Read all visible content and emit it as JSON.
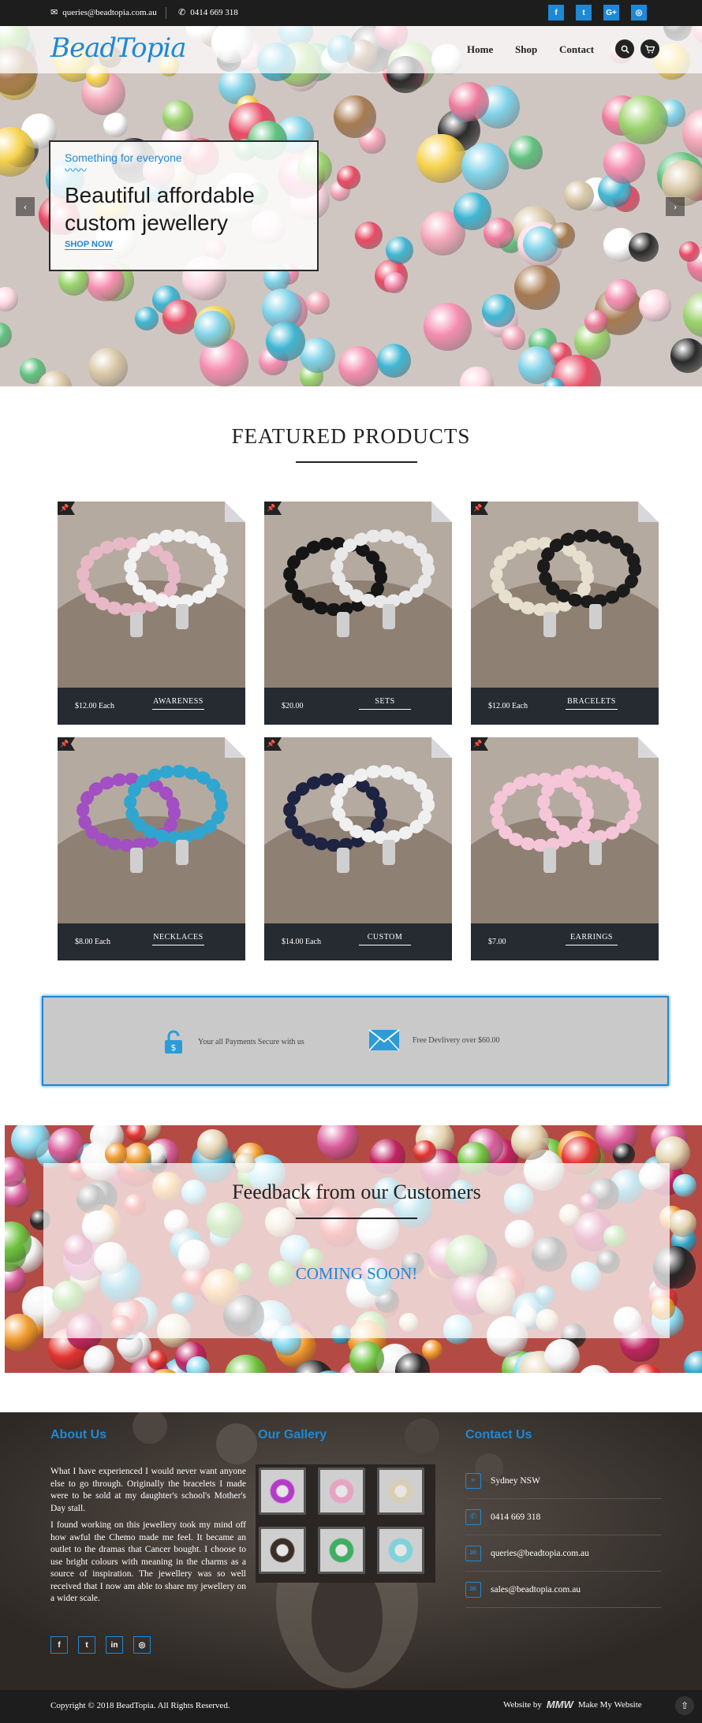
{
  "topbar": {
    "email": "queries@beadtopia.com.au",
    "phone": "0414 669 318",
    "social": [
      {
        "icon": "facebook-icon",
        "glyph": "f"
      },
      {
        "icon": "twitter-icon",
        "glyph": "t"
      },
      {
        "icon": "google-plus-icon",
        "glyph": "G+"
      },
      {
        "icon": "instagram-icon",
        "glyph": "◎"
      }
    ]
  },
  "nav": {
    "logo": "BeadTopia",
    "links": [
      "Home",
      "Shop",
      "Contact"
    ],
    "search_icon": "search-icon",
    "cart_icon": "cart-icon"
  },
  "hero": {
    "subtitle": "Something for everyone",
    "title_line1": "Beautiful affordable",
    "title_line2": "custom jewellery",
    "cta": "SHOP NOW"
  },
  "featured": {
    "title": "FEATURED PRODUCTS",
    "products": [
      {
        "price": "$12.00  Each",
        "category": "AWARENESS"
      },
      {
        "price": "$20.00",
        "category": "SETS"
      },
      {
        "price": "$12.00  Each",
        "category": "BRACELETS"
      },
      {
        "price": "$8.00  Each",
        "category": "NECKLACES"
      },
      {
        "price": "$14.00  Each",
        "category": "CUSTOM"
      },
      {
        "price": "$7.00",
        "category": "EARRINGS"
      }
    ]
  },
  "secure": {
    "payments": "Your all Payments Secure with us",
    "delivery": "Free Devlivery over $60.00"
  },
  "feedback": {
    "title": "Feedback from our Customers",
    "status": "COMING SOON!"
  },
  "footer": {
    "about_title": "About Us",
    "about_p1": "What I have experienced I would never want anyone else to go through. Originally the bracelets I made were to be sold at my daughter's school's Mother's Day stall.",
    "about_p2": "I found working on this jewellery took my mind off how awful the Chemo made me feel. It became an outlet to the dramas that Cancer bought. I choose to use bright colours with meaning in the charms as a source of inspiration. The jewellery was so well received that I now am able to share my jewellery on a wider scale.",
    "gallery_title": "Our Gallery",
    "contact_title": "Contact Us",
    "contact": [
      {
        "icon": "location-icon",
        "text": "Sydney NSW"
      },
      {
        "icon": "phone-icon",
        "text": "0414 669 318"
      },
      {
        "icon": "mail-icon",
        "text": "queries@beadtopia.com.au"
      },
      {
        "icon": "mail-icon",
        "text": "sales@beadtopia.com.au"
      }
    ],
    "social": [
      {
        "icon": "facebook-icon",
        "glyph": "f"
      },
      {
        "icon": "twitter-icon",
        "glyph": "t"
      },
      {
        "icon": "linkedin-icon",
        "glyph": "in"
      },
      {
        "icon": "instagram-icon",
        "glyph": "◎"
      }
    ],
    "copyright": "Copyright © 2018 BeadTopia. All Rights Reserved.",
    "credit_prefix": "Website by",
    "credit_logo": "MMW",
    "credit_name": "Make My Website"
  },
  "colors": {
    "accent": "#1e88d6",
    "dark": "#1d1d1d",
    "card_bar": "#262a31"
  }
}
